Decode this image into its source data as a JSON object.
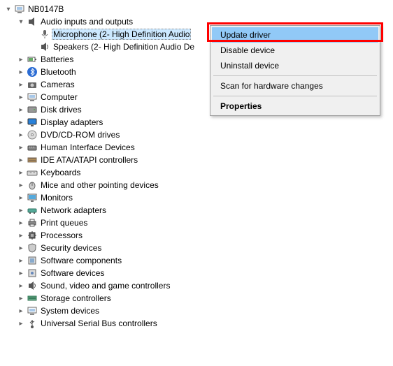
{
  "root": {
    "label": "NB0147B"
  },
  "audio": {
    "label": "Audio inputs and outputs",
    "mic": "Microphone (2- High Definition Audio",
    "spk": "Speakers (2- High Definition Audio De"
  },
  "cats": {
    "batteries": "Batteries",
    "bluetooth": "Bluetooth",
    "cameras": "Cameras",
    "computer": "Computer",
    "disk": "Disk drives",
    "display": "Display adapters",
    "dvd": "DVD/CD-ROM drives",
    "hid": "Human Interface Devices",
    "ide": "IDE ATA/ATAPI controllers",
    "keyboards": "Keyboards",
    "mice": "Mice and other pointing devices",
    "monitors": "Monitors",
    "network": "Network adapters",
    "print": "Print queues",
    "processors": "Processors",
    "security": "Security devices",
    "swcomp": "Software components",
    "swdev": "Software devices",
    "sound": "Sound, video and game controllers",
    "storage": "Storage controllers",
    "system": "System devices",
    "usb": "Universal Serial Bus controllers"
  },
  "menu": {
    "update": "Update driver",
    "disable": "Disable device",
    "uninstall": "Uninstall device",
    "scan": "Scan for hardware changes",
    "properties": "Properties"
  }
}
